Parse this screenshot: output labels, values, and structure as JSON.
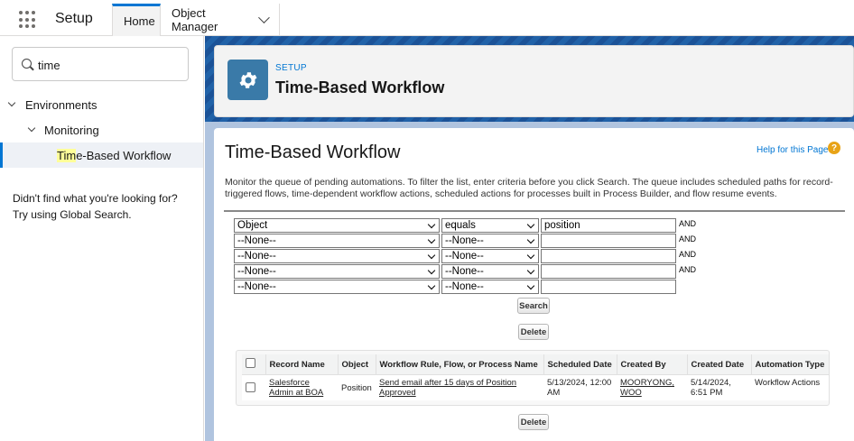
{
  "topbar": {
    "app_name": "Setup",
    "tabs": [
      {
        "label": "Home"
      },
      {
        "label": "Object Manager"
      }
    ]
  },
  "sidebar": {
    "search_value": "time",
    "tree": {
      "environments": "Environments",
      "monitoring": "Monitoring",
      "selected_highlight": "Tim",
      "selected_rest": "e-Based Workflow"
    },
    "not_found_line1": "Didn't find what you're looking for?",
    "not_found_line2": "Try using Global Search."
  },
  "header": {
    "eyebrow": "SETUP",
    "title": "Time-Based Workflow"
  },
  "content": {
    "title": "Time-Based Workflow",
    "help_link": "Help for this Page",
    "help_icon": "?",
    "description": "Monitor the queue of pending automations. To filter the list, enter criteria before you click Search. The queue includes scheduled paths for record-triggered flows, time-dependent workflow actions, scheduled actions for processes built in Process Builder, and flow resume events.",
    "filters": [
      {
        "field": "Object",
        "operator": "equals",
        "value": "position",
        "conj": "AND"
      },
      {
        "field": "--None--",
        "operator": "--None--",
        "value": "",
        "conj": "AND"
      },
      {
        "field": "--None--",
        "operator": "--None--",
        "value": "",
        "conj": "AND"
      },
      {
        "field": "--None--",
        "operator": "--None--",
        "value": "",
        "conj": "AND"
      },
      {
        "field": "--None--",
        "operator": "--None--",
        "value": "",
        "conj": ""
      }
    ],
    "search_button": "Search",
    "delete_button": "Delete",
    "table": {
      "columns": [
        "Record Name",
        "Object",
        "Workflow Rule, Flow, or Process Name",
        "Scheduled Date",
        "Created By",
        "Created Date",
        "Automation Type"
      ],
      "rows": [
        {
          "record_name": "Salesforce Admin at BOA",
          "object": "Position",
          "workflow": "Send email after 15 days of Position Approved",
          "scheduled_date": "5/13/2024, 12:00 AM",
          "created_by": "MOORYONG, WOO",
          "created_date": "5/14/2024, 6:51 PM",
          "automation_type": "Workflow Actions"
        }
      ]
    },
    "delete_button_bottom": "Delete"
  },
  "colors": {
    "accent": "#0176d3",
    "header_icon": "#3a7aa8",
    "help_icon": "#e8a317"
  },
  "icons": {
    "app_launcher": "waffle-icon",
    "search": "search-icon",
    "header": "gear-icon",
    "help": "help-icon"
  }
}
